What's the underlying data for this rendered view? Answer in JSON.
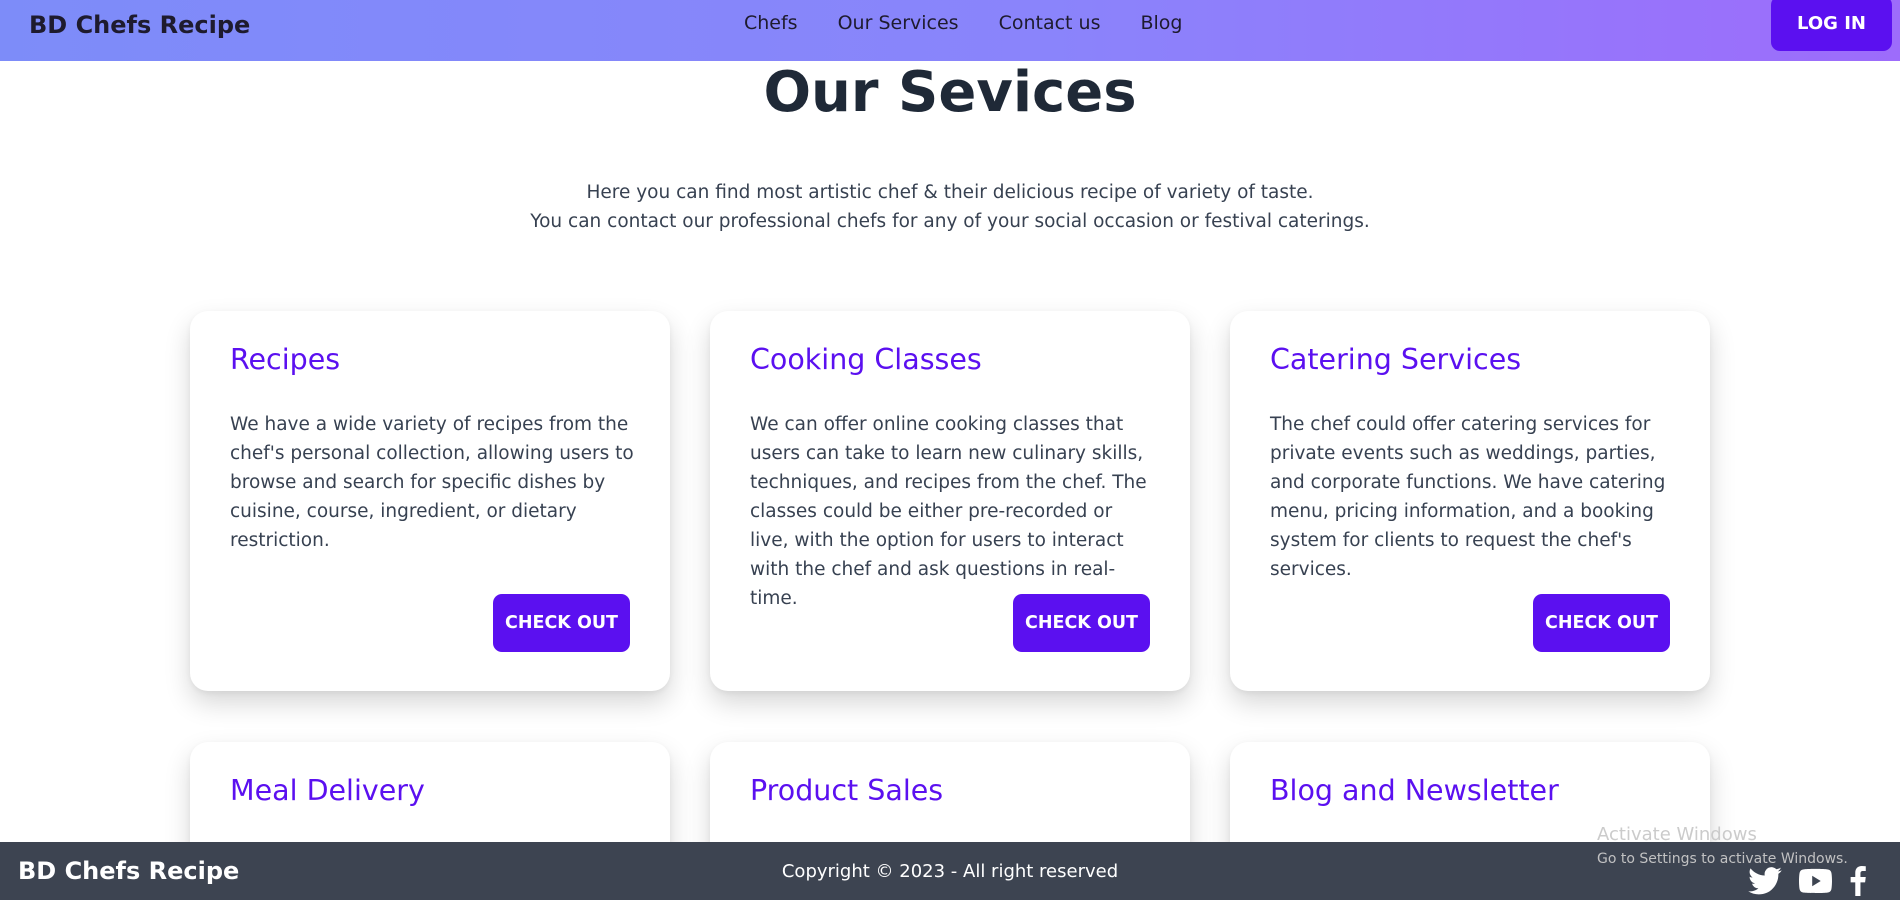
{
  "navbar": {
    "brand": "BD Chefs Recipe",
    "links": [
      "Chefs",
      "Our Services",
      "Contact us",
      "Blog"
    ],
    "login_label": "LOG IN"
  },
  "header": {
    "title": "Our Sevices",
    "intro_line1": "Here you can find most artistic chef & their delicious recipe of variety of taste.",
    "intro_line2": "You can contact our professional chefs for any of your social occasion or festival caterings."
  },
  "services": [
    {
      "title": "Recipes",
      "text": "We have a wide variety of recipes from the chef's personal collection, allowing users to browse and search for specific dishes by cuisine, course, ingredient, or dietary restriction.",
      "button": "CHECK OUT"
    },
    {
      "title": "Cooking Classes",
      "text": "We can offer online cooking classes that users can take to learn new culinary skills, techniques, and recipes from the chef. The classes could be either pre-recorded or live, with the option for users to interact with the chef and ask questions in real-time.",
      "button": "CHECK OUT"
    },
    {
      "title": "Catering Services",
      "text": "The chef could offer catering services for private events such as weddings, parties, and corporate functions. We have catering menu, pricing information, and a booking system for clients to request the chef's services.",
      "button": "CHECK OUT"
    },
    {
      "title": "Meal Delivery"
    },
    {
      "title": "Product Sales"
    },
    {
      "title": "Blog and Newsletter"
    }
  ],
  "footer": {
    "brand": "BD Chefs Recipe",
    "copyright": "Copyright © 2023 - All right reserved",
    "social_icons": [
      "twitter-icon",
      "youtube-icon",
      "facebook-icon"
    ]
  },
  "watermark": {
    "title": "Activate Windows",
    "subtitle": "Go to Settings to activate Windows."
  },
  "colors": {
    "accent": "#5b10f0",
    "footer_bg": "#3d4451",
    "nav_gradient_start": "#7d8cf9",
    "nav_gradient_end": "#9d6cfb"
  }
}
